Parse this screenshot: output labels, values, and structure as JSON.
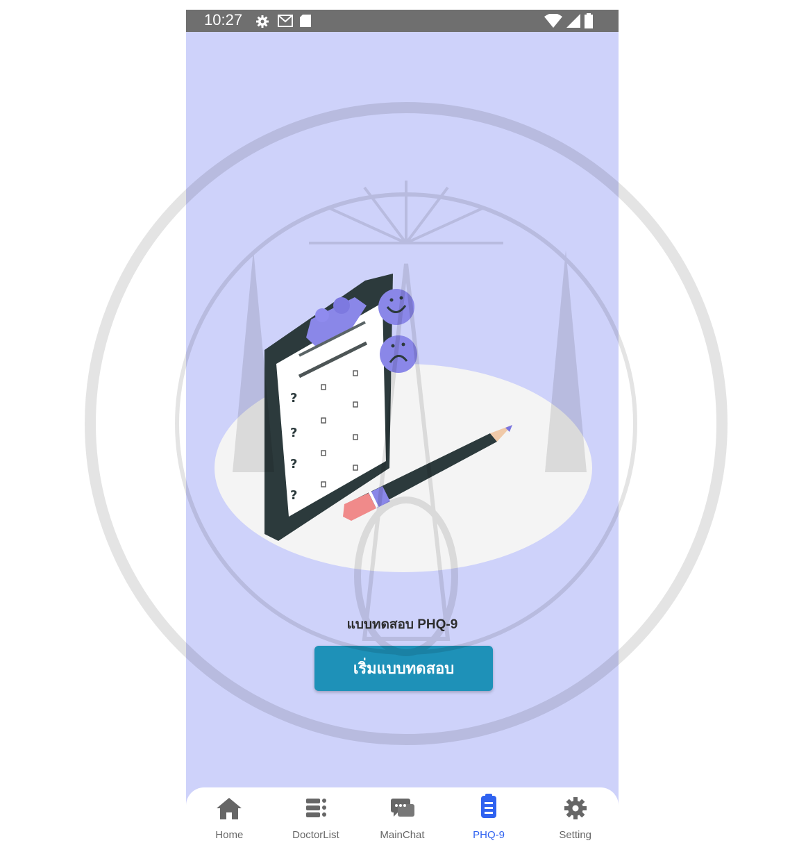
{
  "status_bar": {
    "time": "10:27",
    "icons": [
      "settings-icon",
      "gmail-icon",
      "sd-card-icon",
      "wifi-icon",
      "signal-icon",
      "battery-icon"
    ]
  },
  "main": {
    "illustration": "clipboard-checklist-illustration",
    "title": "แบบทดสอบ PHQ-9",
    "start_button_label": "เริ่มแบบทดสอบ"
  },
  "bottom_nav": {
    "items": [
      {
        "label": "Home",
        "icon": "home-icon"
      },
      {
        "label": "DoctorList",
        "icon": "list-icon"
      },
      {
        "label": "MainChat",
        "icon": "chat-icon"
      },
      {
        "label": "PHQ-9",
        "icon": "clipboard-icon",
        "active": true
      },
      {
        "label": "Setting",
        "icon": "gear-icon"
      }
    ]
  },
  "colors": {
    "background": "#ced2fa",
    "button": "#1e91b8",
    "active_nav": "#2f62f0",
    "inactive_nav": "#666666"
  }
}
